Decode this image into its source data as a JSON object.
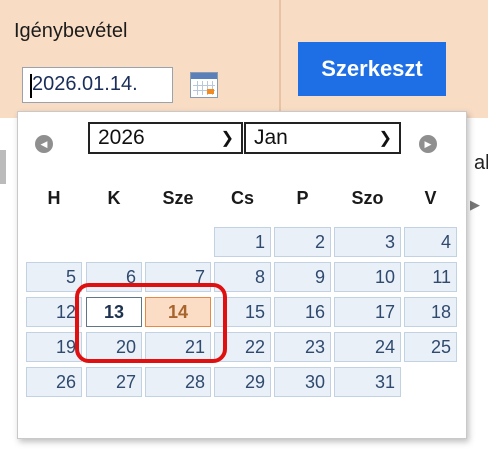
{
  "field": {
    "label": "Igénybevétel",
    "value": "2026.01.14."
  },
  "edit_button": {
    "label": "Szerkeszt"
  },
  "background": {
    "partial_label": "al"
  },
  "calendar": {
    "year": "2026",
    "month": "Jan",
    "weekdays": [
      "H",
      "K",
      "Sze",
      "Cs",
      "P",
      "Szo",
      "V"
    ],
    "weeks": [
      [
        "",
        "",
        "",
        "1",
        "2",
        "3",
        "4"
      ],
      [
        "5",
        "6",
        "7",
        "8",
        "9",
        "10",
        "11"
      ],
      [
        "12",
        "13",
        "14",
        "15",
        "16",
        "17",
        "18"
      ],
      [
        "19",
        "20",
        "21",
        "22",
        "23",
        "24",
        "25"
      ],
      [
        "26",
        "27",
        "28",
        "29",
        "30",
        "31",
        ""
      ]
    ],
    "today": "13",
    "selected": "14"
  },
  "colors": {
    "accent": "#1e6fe6",
    "highlight": "#e01010",
    "selected_bg": "#fbdcc4"
  }
}
